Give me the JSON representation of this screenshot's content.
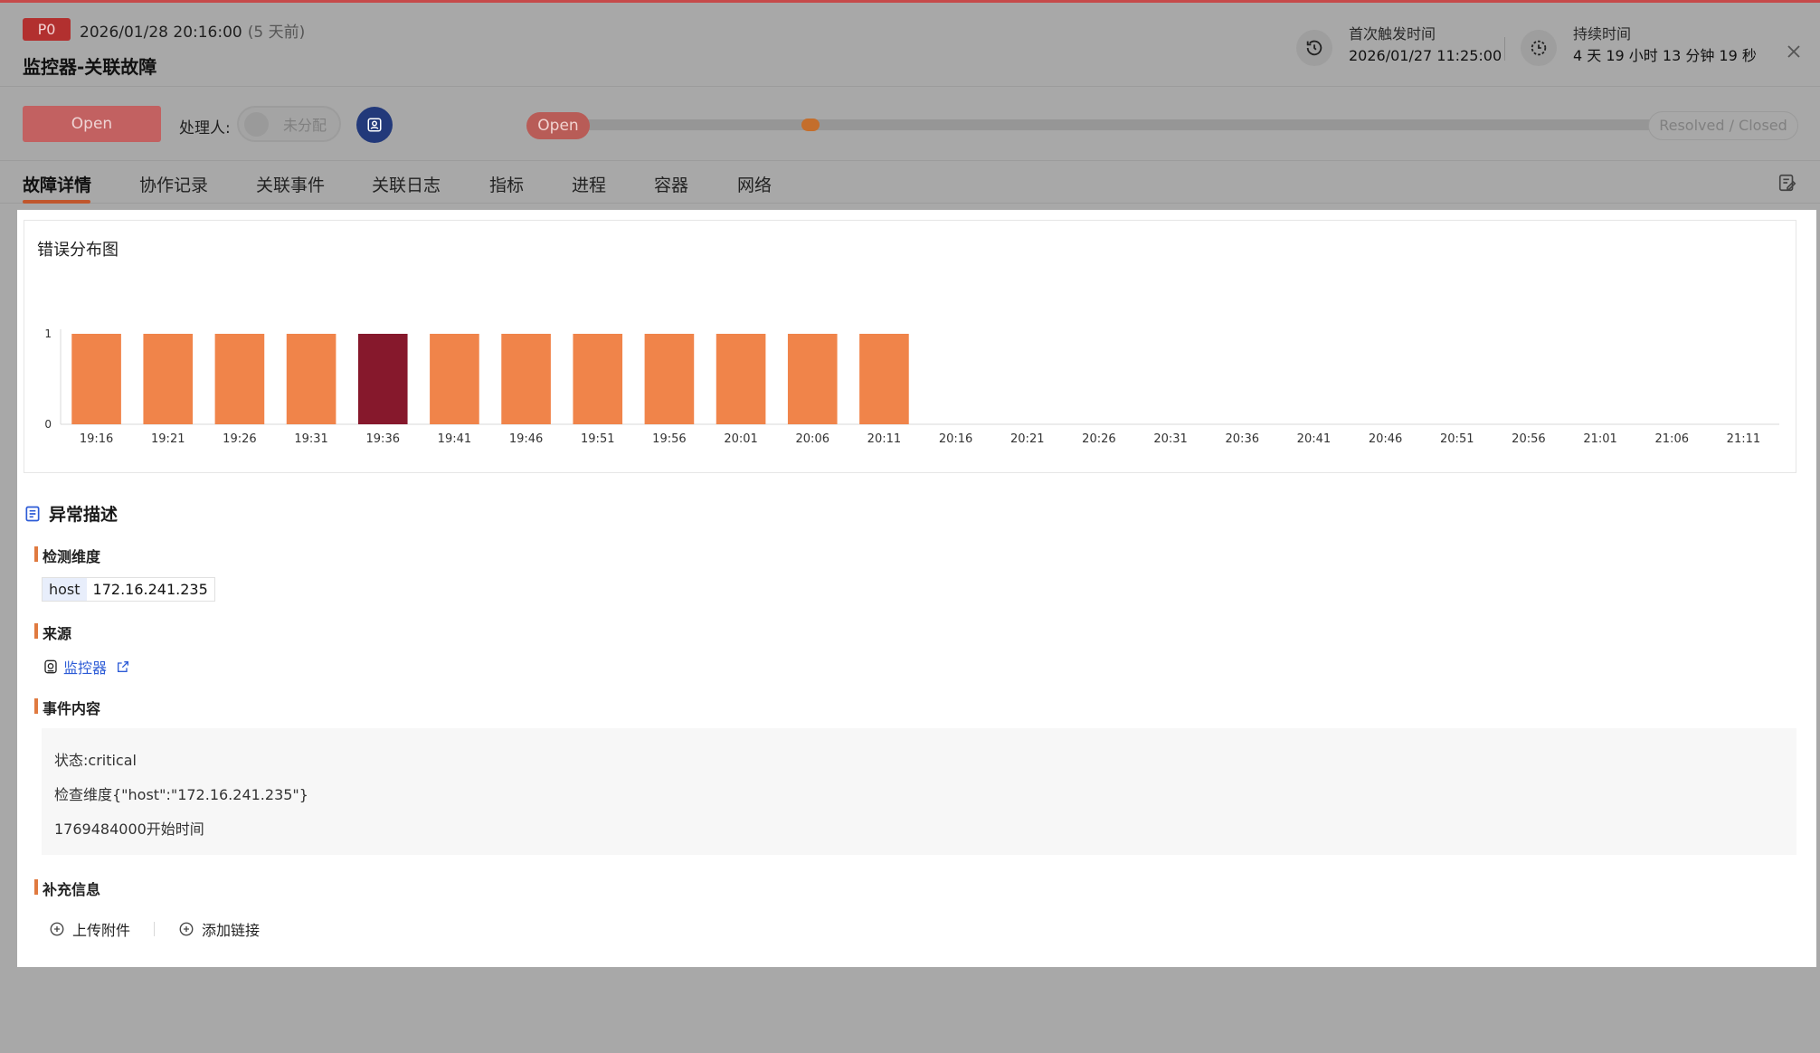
{
  "header": {
    "priority": "P0",
    "trigger_time": "2026/01/28 20:16:00",
    "trigger_ago": "(5 天前)",
    "title": "监控器-关联故障",
    "first_trigger_label": "首次触发时间",
    "first_trigger_value": "2026/01/27 11:25:00",
    "duration_label": "持续时间",
    "duration_value": "4 天 19 小时 13 分钟 19 秒"
  },
  "actions": {
    "status_button": "Open",
    "assignee_label": "处理人:",
    "assignee_placeholder": "未分配",
    "track_start": "Open",
    "track_end": "Resolved / Closed",
    "track_progress": 0.2
  },
  "tabs": [
    {
      "label": "故障详情",
      "active": true
    },
    {
      "label": "协作记录"
    },
    {
      "label": "关联事件"
    },
    {
      "label": "关联日志"
    },
    {
      "label": "指标"
    },
    {
      "label": "进程"
    },
    {
      "label": "容器"
    },
    {
      "label": "网络"
    }
  ],
  "chart_data": {
    "type": "bar",
    "title": "错误分布图",
    "categories": [
      "19:16",
      "19:21",
      "19:26",
      "19:31",
      "19:36",
      "19:41",
      "19:46",
      "19:51",
      "19:56",
      "20:01",
      "20:06",
      "20:11",
      "20:16",
      "20:21",
      "20:26",
      "20:31",
      "20:36",
      "20:41",
      "20:46",
      "20:51",
      "20:56",
      "21:01",
      "21:06",
      "21:11"
    ],
    "values": [
      1,
      1,
      1,
      1,
      1,
      1,
      1,
      1,
      1,
      1,
      1,
      1,
      0,
      0,
      0,
      0,
      0,
      0,
      0,
      0,
      0,
      0,
      0,
      0
    ],
    "highlight_index": 4,
    "ylim": [
      0,
      1
    ],
    "yticks": [
      0,
      1
    ],
    "colors": {
      "bar": "#f0844a",
      "highlight": "#86182c",
      "axis": "#d8d8d8"
    }
  },
  "description": {
    "section_title": "异常描述",
    "dimension_heading": "检测维度",
    "dimension_key": "host",
    "dimension_value": "172.16.241.235",
    "source_heading": "来源",
    "source_link": "监控器",
    "event_heading": "事件内容",
    "event_lines": [
      "状态:critical",
      "检查维度{\"host\":\"172.16.241.235\"}",
      "1769484000开始时间"
    ],
    "extra_heading": "补充信息",
    "upload_label": "上传附件",
    "add_link_label": "添加链接"
  }
}
